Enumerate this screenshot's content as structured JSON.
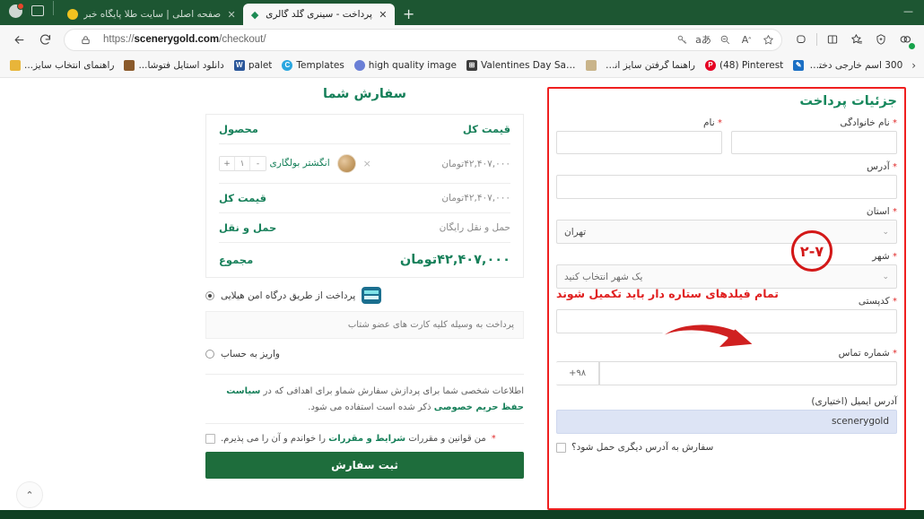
{
  "browser": {
    "window_controls": {
      "minimize": "—"
    },
    "tabs": [
      {
        "title": "صفحه اصلی | سایت طلا پایگاه خبر",
        "favicon": "yellow-dot",
        "active": false,
        "close": "✕"
      },
      {
        "title": "پرداخت - سینری گلد گالری",
        "favicon": "diamond",
        "active": true,
        "close": "✕"
      }
    ],
    "new_tab_label": "+",
    "nav": {
      "back": "←",
      "reload": "⟳",
      "lock": "🔒"
    },
    "url": {
      "scheme": "https://",
      "domain": "scenerygold.com",
      "path": "/checkout/"
    },
    "toolbar_icons": [
      "key-icon",
      "read-aloud-icon",
      "zoom-out-icon",
      "font-style-icon",
      "favorite-star-icon",
      "copilot-icon",
      "split-screen-icon",
      "collections-icon",
      "browser-essentials-icon",
      "extensions-icon"
    ],
    "bookmarks": [
      {
        "label": "راهنمای انتخاب سایز...",
        "favicon_color": "#e8b53a",
        "favicon_text": ""
      },
      {
        "label": "دانلود استایل فتوشا...",
        "favicon_color": "#8a5a2b",
        "favicon_text": ""
      },
      {
        "label": "palet",
        "favicon_color": "#2b579a",
        "favicon_text": "W"
      },
      {
        "label": "Templates",
        "favicon_color": "#2aa7e0",
        "favicon_text": "C"
      },
      {
        "label": "high quality image",
        "favicon_color": "#6a7fd6",
        "favicon_text": ""
      },
      {
        "label": "Valentines Day Sale...",
        "favicon_color": "#3c3c3c",
        "favicon_text": "⊞"
      },
      {
        "label": "راهنما گرفتن سایز انگ...",
        "favicon_color": "#c9b48a",
        "favicon_text": ""
      },
      {
        "label": "(48) Pinterest",
        "favicon_color": "#e60023",
        "favicon_text": "P"
      },
      {
        "label": "300 اسم خارجی دخترا...",
        "favicon_color": "#1b6fc4",
        "favicon_text": "✎"
      }
    ],
    "bookmark_overflow": "›",
    "bookmark_folder": "📁"
  },
  "payment_details": {
    "heading": "جزئیات پرداخت",
    "first_name": {
      "label": "نام",
      "required": "*",
      "value": ""
    },
    "last_name": {
      "label": "نام خانوادگی",
      "required": "*",
      "value": ""
    },
    "address": {
      "label": "آدرس",
      "required": "*",
      "value": ""
    },
    "province": {
      "label": "استان",
      "required": "*",
      "value": "تهران",
      "caret": "⌄"
    },
    "city": {
      "label": "شهر",
      "required": "*",
      "value": "یک شهر انتخاب کنید",
      "caret": "⌄"
    },
    "postcode": {
      "label": "کدپستی",
      "required": "*",
      "value": ""
    },
    "phone": {
      "label": "شماره تماس",
      "required": "*",
      "country_code": "۹۸+",
      "value": ""
    },
    "email": {
      "label": "آدرس ایمیل (اختیاری)",
      "value": "scenerygold"
    },
    "ship_other": {
      "label": "سفارش به آدرس دیگری حمل شود؟",
      "checked": false
    }
  },
  "annotations": {
    "step_badge": "۲-۷",
    "note": "تمام فیلدهای ستاره دار باید تکمیل شوند"
  },
  "order_summary": {
    "heading": "سفارش شما",
    "columns": {
      "product": "محصول",
      "total": "قیمت کل"
    },
    "items": [
      {
        "name": "انگشتر بولگاری",
        "quantity": "۱",
        "qty_plus": "+",
        "qty_minus": "-",
        "remove": "×",
        "price": "۴۲,۴۰۷,۰۰۰تومان"
      }
    ],
    "subtotal": {
      "label": "قیمت کل",
      "value": "۴۲,۴۰۷,۰۰۰تومان"
    },
    "shipping": {
      "label": "حمل و نقل",
      "value": "حمل و نقل رایگان"
    },
    "total": {
      "label": "مجموع",
      "value": "۴۲,۴۰۷,۰۰۰تومان"
    },
    "payment_methods": [
      {
        "label": "پرداخت از طریق درگاه امن هیلایی",
        "selected": true,
        "has_gateway_icon": true
      },
      {
        "label": "واریز به حساب",
        "selected": false,
        "has_gateway_icon": false
      }
    ],
    "payment_note": "پرداخت به وسیله کلیه کارت های عضو شتاب",
    "privacy_text_1": "اطلاعات شخصی شما برای پردازش سفارش شماو برای اهدافی که در ",
    "privacy_link": "سیاست حفظ حریم خصوصی",
    "privacy_text_2": " ذکر شده است استفاده می شود.",
    "terms_text_1": "من قوانین و مقررات ",
    "terms_link": "شرایط و مقررات",
    "terms_text_2": " را خواندم و آن را می پذیرم.",
    "terms_required": "*",
    "place_order": "ثبت سفارش"
  },
  "scroll_to_top": "⌃"
}
